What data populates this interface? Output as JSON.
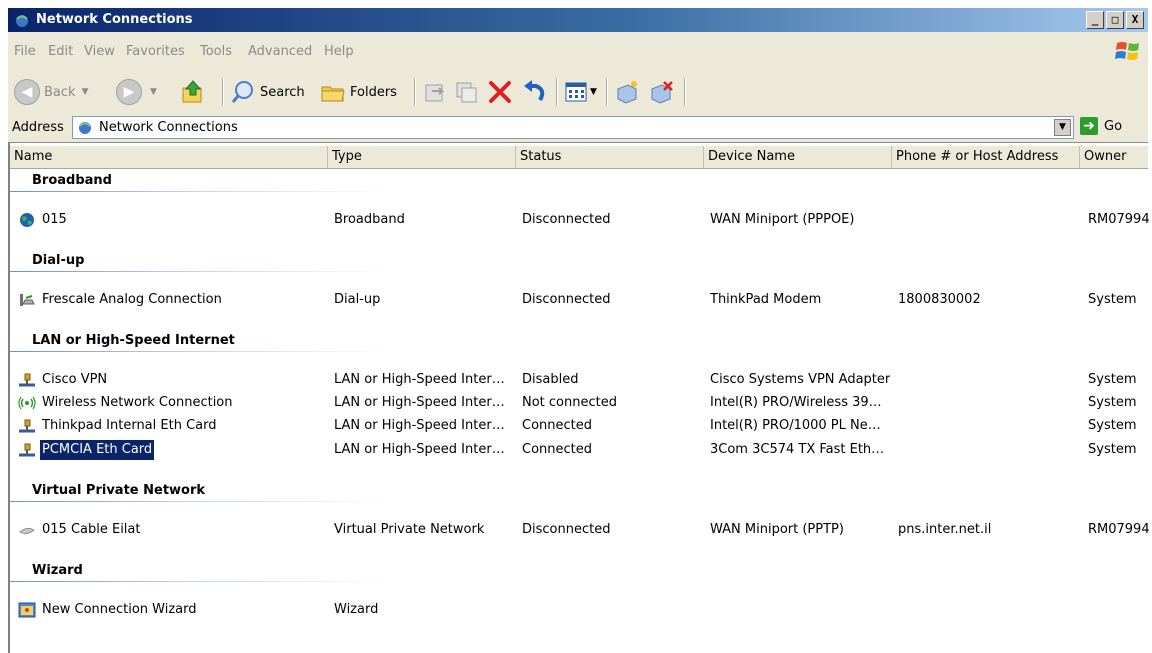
{
  "window": {
    "title": "Network Connections",
    "controls": [
      "_",
      "□",
      "X"
    ]
  },
  "menu": [
    "File",
    "Edit",
    "View",
    "Favorites",
    "Tools",
    "Advanced",
    "Help"
  ],
  "toolbar": {
    "back_label": "Back",
    "search_label": "Search",
    "folders_label": "Folders"
  },
  "address": {
    "label": "Address",
    "value": "Network Connections",
    "go_label": "Go"
  },
  "columns": [
    "Name",
    "Type",
    "Status",
    "Device Name",
    "Phone # or Host Address",
    "Owner"
  ],
  "groups": [
    {
      "title": "Broadband",
      "rows": [
        {
          "name": "015",
          "type": "Broadband",
          "status": "Disconnected",
          "device": "WAN Miniport (PPPOE)",
          "phone": "",
          "owner": "RM07994",
          "icon": "globe-icon"
        }
      ]
    },
    {
      "title": "Dial-up",
      "rows": [
        {
          "name": "Frescale Analog Connection",
          "type": "Dial-up",
          "status": "Disconnected",
          "device": "ThinkPad Modem",
          "phone": "1800830002",
          "owner": "System",
          "icon": "phone-icon"
        }
      ]
    },
    {
      "title": "LAN or High-Speed Internet",
      "rows": [
        {
          "name": "Cisco VPN",
          "type": "LAN or High-Speed Inter…",
          "status": "Disabled",
          "device": "Cisco Systems VPN Adapter",
          "phone": "",
          "owner": "System",
          "icon": "network-cable-icon"
        },
        {
          "name": "Wireless Network Connection",
          "type": "LAN or High-Speed Inter…",
          "status": "Not connected",
          "device": "Intel(R) PRO/Wireless 39…",
          "phone": "",
          "owner": "System",
          "icon": "wireless-icon"
        },
        {
          "name": "Thinkpad Internal Eth Card",
          "type": "LAN or High-Speed Inter…",
          "status": "Connected",
          "device": "Intel(R) PRO/1000 PL Ne…",
          "phone": "",
          "owner": "System",
          "icon": "network-cable-icon"
        },
        {
          "name": "PCMCIA Eth Card",
          "type": "LAN or High-Speed Inter…",
          "status": "Connected",
          "device": "3Com 3C574 TX Fast Eth…",
          "phone": "",
          "owner": "System",
          "icon": "network-cable-icon",
          "selected": true
        }
      ]
    },
    {
      "title": "Virtual Private Network",
      "rows": [
        {
          "name": "015 Cable Eilat",
          "type": "Virtual Private Network",
          "status": "Disconnected",
          "device": "WAN Miniport (PPTP)",
          "phone": "pns.inter.net.il",
          "owner": "RM07994",
          "icon": "vpn-icon"
        }
      ]
    },
    {
      "title": "Wizard",
      "rows": [
        {
          "name": "New Connection Wizard",
          "type": "Wizard",
          "status": "",
          "device": "",
          "phone": "",
          "owner": "",
          "icon": "wizard-icon"
        }
      ]
    }
  ]
}
